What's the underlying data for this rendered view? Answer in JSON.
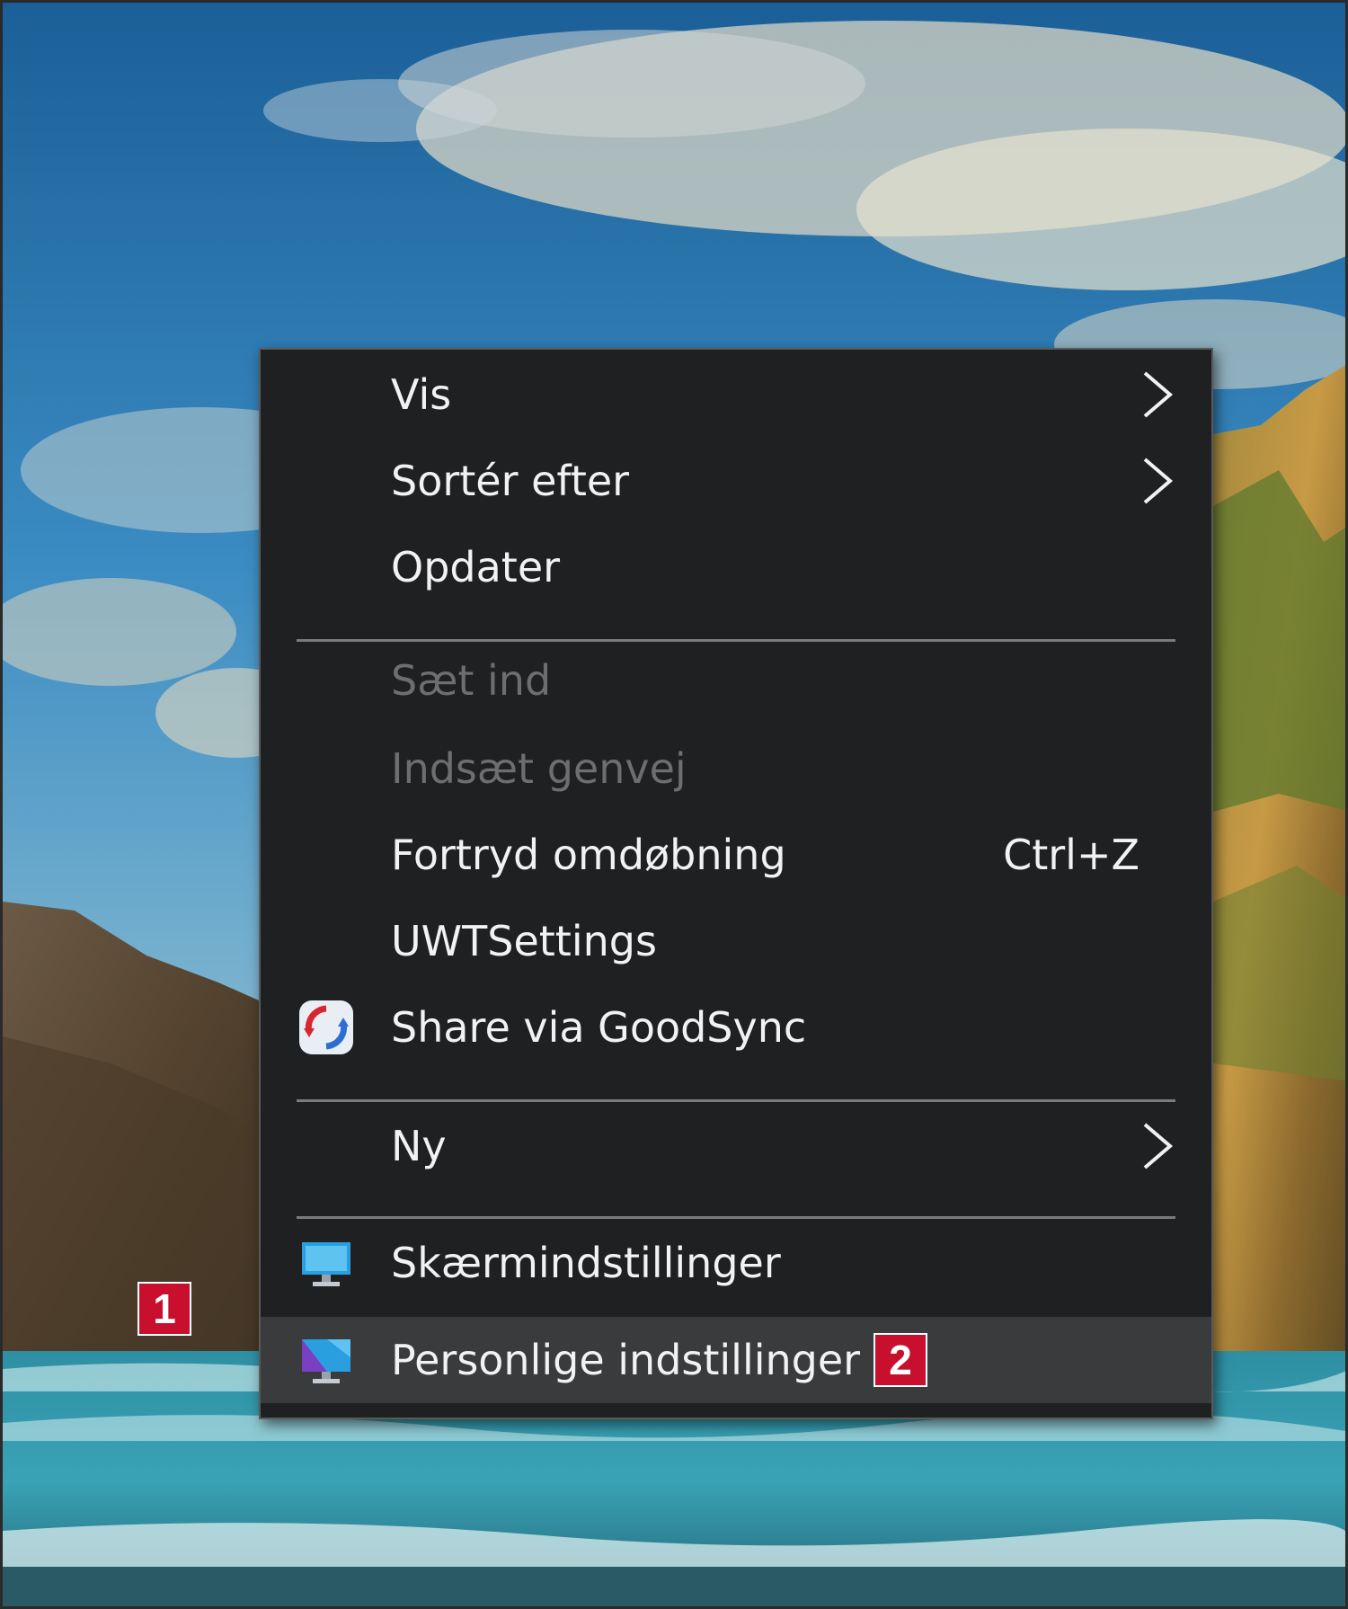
{
  "context_menu": {
    "items": [
      {
        "label": "Vis",
        "has_submenu": true
      },
      {
        "label": "Sortér efter",
        "has_submenu": true
      },
      {
        "label": "Opdater"
      },
      {
        "label": "Sæt ind",
        "disabled": true
      },
      {
        "label": "Indsæt genvej",
        "disabled": true
      },
      {
        "label": "Fortryd omdøbning",
        "shortcut": "Ctrl+Z"
      },
      {
        "label": "UWTSettings"
      },
      {
        "label": "Share via GoodSync",
        "icon": "goodsync-icon"
      },
      {
        "label": "Ny",
        "has_submenu": true
      },
      {
        "label": "Skærmindstillinger",
        "icon": "display-settings-icon"
      },
      {
        "label": "Personlige indstillinger",
        "icon": "personalize-icon",
        "hovered": true
      }
    ]
  },
  "annotations": {
    "badge_1": "1",
    "badge_2": "2"
  },
  "colors": {
    "menu_background": "#1f2022",
    "menu_text": "#f2f2f2",
    "disabled_text": "#6d6e70",
    "hover_background": "#3a3b3d",
    "badge": "#c8102e"
  }
}
